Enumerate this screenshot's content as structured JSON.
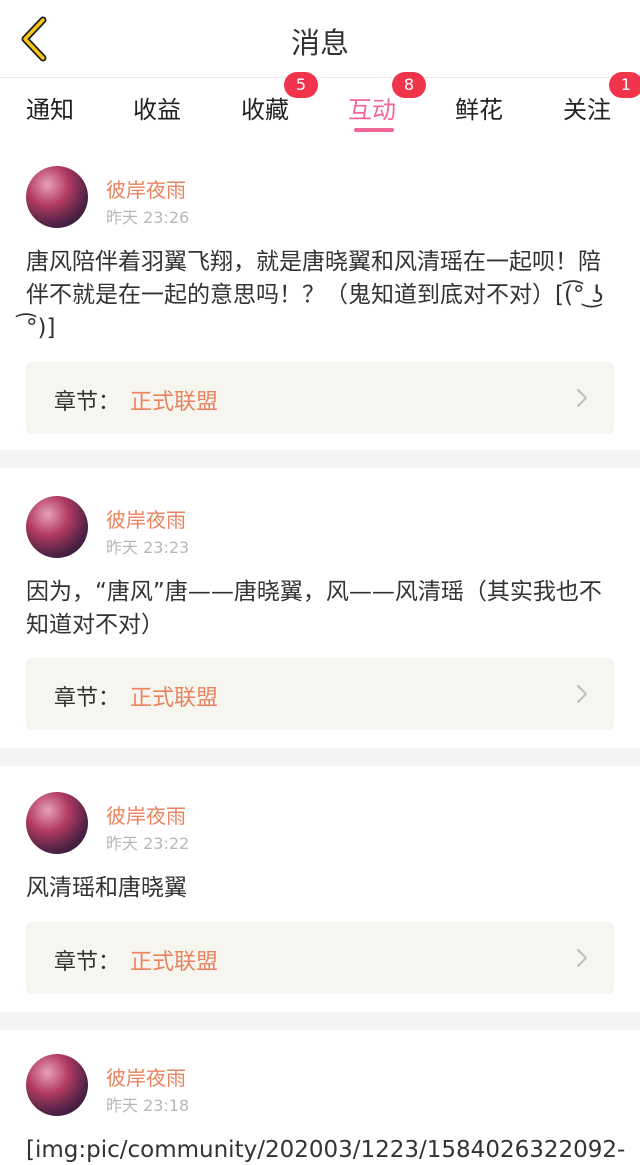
{
  "header": {
    "title": "消息",
    "back_icon": "chevron-left-icon",
    "accent": "#f5c518"
  },
  "tabs": [
    {
      "label": "通知",
      "badge": ""
    },
    {
      "label": "收益",
      "badge": ""
    },
    {
      "label": "收藏",
      "badge": "5"
    },
    {
      "label": "互动",
      "badge": "8",
      "active": true
    },
    {
      "label": "鲜花",
      "badge": ""
    },
    {
      "label": "关注",
      "badge": "1"
    }
  ],
  "colors": {
    "active_tab": "#f2679a",
    "badge": "#f0344c",
    "author": "#e9845f",
    "chapter_bg": "#f6f5f0"
  },
  "messages": [
    {
      "author": "彼岸夜雨",
      "time": "昨天 23:26",
      "content": "唐风陪伴着羽翼飞翔，就是唐晓翼和风清瑶在一起呗！陪伴不就是在一起的意思吗！？（鬼知道到底对不对）[(͡° ͜ʖ ͡°)]",
      "chapter_prefix": "章节：",
      "chapter_name": "正式联盟"
    },
    {
      "author": "彼岸夜雨",
      "time": "昨天 23:23",
      "content": "因为，“唐风”唐——唐晓翼，风——风清瑶（其实我也不知道对不对）",
      "chapter_prefix": "章节：",
      "chapter_name": "正式联盟"
    },
    {
      "author": "彼岸夜雨",
      "time": "昨天 23:22",
      "content": "风清瑶和唐晓翼",
      "chapter_prefix": "章节：",
      "chapter_name": "正式联盟"
    },
    {
      "author": "彼岸夜雨",
      "time": "昨天 23:18",
      "content": "[img:pic/community/202003/1223/1584026322092-",
      "chapter_prefix": "",
      "chapter_name": ""
    }
  ]
}
